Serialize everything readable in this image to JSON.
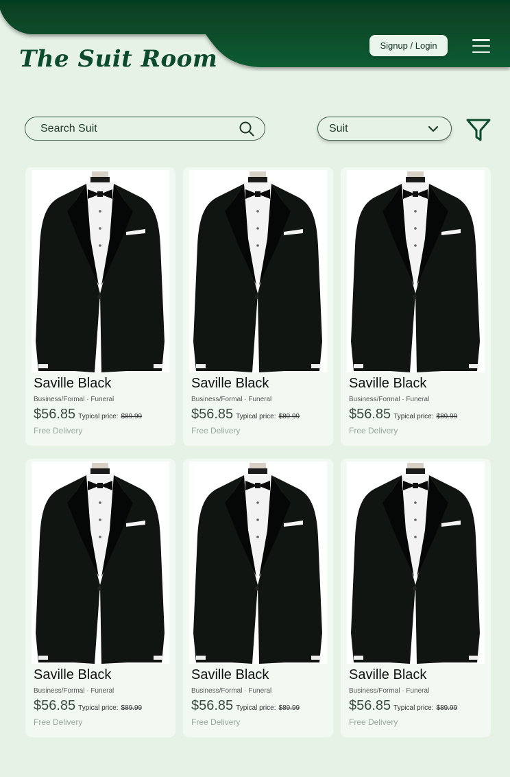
{
  "header": {
    "brand": "The Suit Room",
    "signup_label": "Signup / Login",
    "menu_icon": "hamburger-icon",
    "bg_color": "#0b4a2a"
  },
  "search": {
    "placeholder": "Search Suit",
    "icon": "search-icon"
  },
  "category": {
    "selected": "Suit",
    "icon": "chevron-down-icon"
  },
  "filter": {
    "icon": "filter-icon"
  },
  "products": [
    {
      "name": "Saville Black",
      "tags": "Business/Formal · Funeral",
      "price": "$56.85",
      "typical_label": "Typical price:",
      "typical_price": "$89.99",
      "delivery": "Free Delivery"
    },
    {
      "name": "Saville Black",
      "tags": "Business/Formal · Funeral",
      "price": "$56.85",
      "typical_label": "Typical price:",
      "typical_price": "$89.99",
      "delivery": "Free Delivery"
    },
    {
      "name": "Saville Black",
      "tags": "Business/Formal · Funeral",
      "price": "$56.85",
      "typical_label": "Typical price:",
      "typical_price": "$89.99",
      "delivery": "Free Delivery"
    },
    {
      "name": "Saville Black",
      "tags": "Business/Formal · Funeral",
      "price": "$56.85",
      "typical_label": "Typical price:",
      "typical_price": "$89.99",
      "delivery": "Free Delivery"
    },
    {
      "name": "Saville Black",
      "tags": "Business/Formal · Funeral",
      "price": "$56.85",
      "typical_label": "Typical price:",
      "typical_price": "$89.99",
      "delivery": "Free Delivery"
    },
    {
      "name": "Saville Black",
      "tags": "Business/Formal · Funeral",
      "price": "$56.85",
      "typical_label": "Typical price:",
      "typical_price": "$89.99",
      "delivery": "Free Delivery"
    }
  ]
}
